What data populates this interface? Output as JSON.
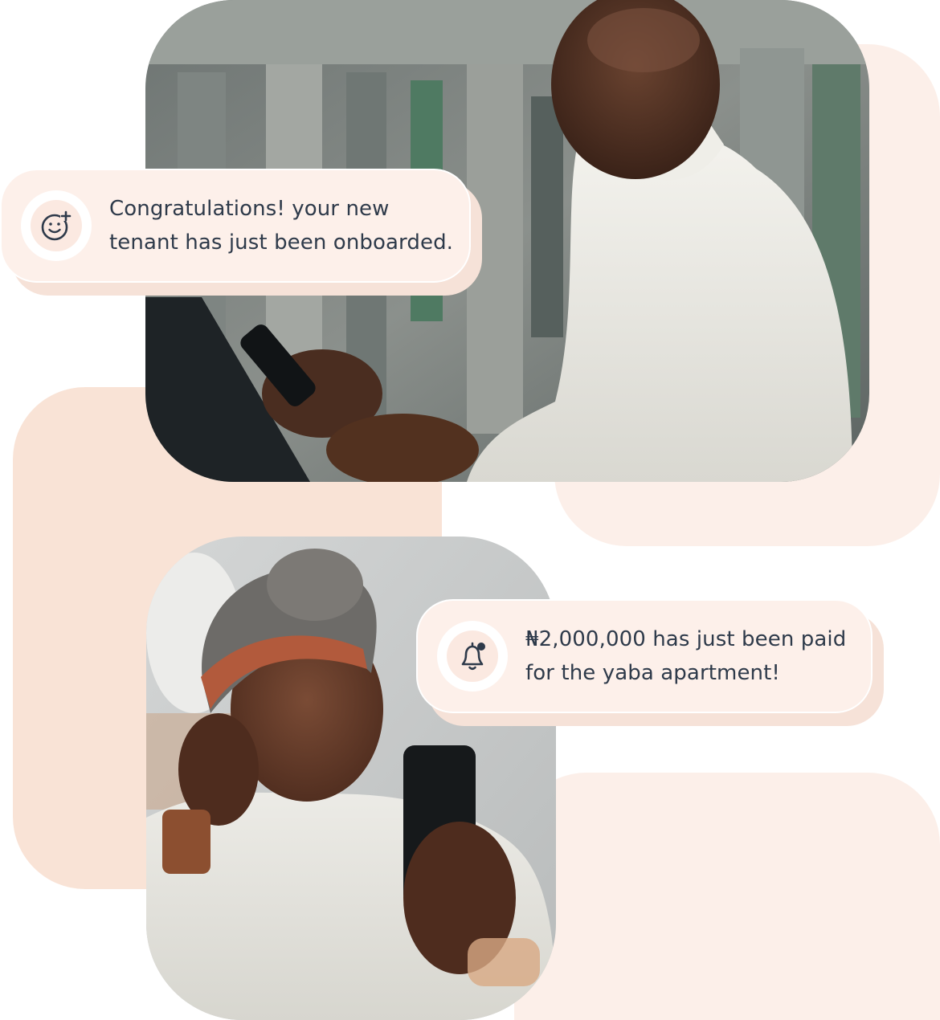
{
  "colors": {
    "blob_peach": "#f9e3d6",
    "blob_light": "#fcefe9",
    "toast_bg": "#fdf0ea",
    "toast_border": "#ffffff",
    "toast_shadow": "#f6e2d8",
    "icon_circle": "#ffffff",
    "icon_inner": "#fbe9e1",
    "icon_stroke": "#2e3a4a",
    "text_primary": "#2e3a4a"
  },
  "notifications": [
    {
      "icon": "smiley-plus-icon",
      "lines": [
        "Congratulations! your new",
        "tenant has just been onboarded."
      ]
    },
    {
      "icon": "bell-dot-icon",
      "lines": [
        "₦2,000,000 has just been paid",
        "for the yaba apartment!"
      ]
    }
  ],
  "photos": [
    {
      "subject": "man-with-phone-photo"
    },
    {
      "subject": "woman-with-phone-photo"
    }
  ]
}
